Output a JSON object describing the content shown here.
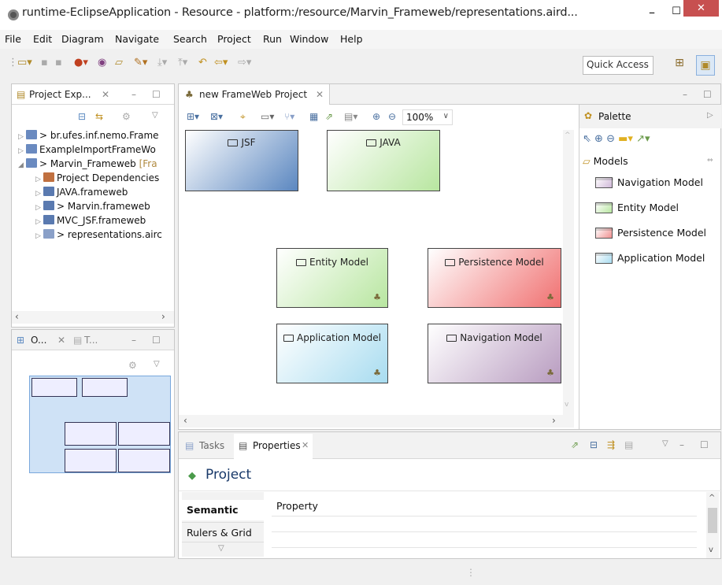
{
  "window": {
    "title": "runtime-EclipseApplication - Resource - platform:/resource/Marvin_Frameweb/representations.aird...",
    "minimize": "–",
    "maximize": "☐",
    "close": "✕"
  },
  "menu": [
    "File",
    "Edit",
    "Diagram",
    "Navigate",
    "Search",
    "Project",
    "Run",
    "Window",
    "Help"
  ],
  "toolbar": {
    "quick_access": "Quick Access"
  },
  "project_explorer": {
    "tab": "Project Exp...",
    "items": [
      {
        "label": "> br.ufes.inf.nemo.Frame",
        "arrow": "▷"
      },
      {
        "label": "ExampleImportFrameWo",
        "arrow": "▷"
      },
      {
        "label": "> Marvin_Frameweb",
        "suffix": "[Fra",
        "arrow": "◢"
      },
      {
        "label": "Project Dependencies",
        "arrow": "▷"
      },
      {
        "label": "JAVA.frameweb",
        "arrow": "▷"
      },
      {
        "label": "> Marvin.frameweb",
        "arrow": "▷"
      },
      {
        "label": "MVC_JSF.frameweb",
        "arrow": "▷"
      },
      {
        "label": "> representations.airc",
        "arrow": "▷"
      }
    ]
  },
  "outline": {
    "tab1": "O...",
    "tab2": "T..."
  },
  "editor": {
    "tab": "new FrameWeb Project",
    "zoom": "100%",
    "nodes": [
      {
        "label": "JSF",
        "color_top": "#ffffff",
        "color_bottom": "#5b87c0"
      },
      {
        "label": "JAVA",
        "color_top": "#ffffff",
        "color_bottom": "#b8e6a0"
      },
      {
        "label": "Entity Model",
        "color_top": "#ffffff",
        "color_bottom": "#b8e6a0"
      },
      {
        "label": "Persistence Model",
        "color_top": "#ffffff",
        "color_bottom": "#f07070"
      },
      {
        "label": "Application Model",
        "color_top": "#ffffff",
        "color_bottom": "#a8dcf0"
      },
      {
        "label": "Navigation Model",
        "color_top": "#ffffff",
        "color_bottom": "#b89cc0"
      }
    ]
  },
  "palette": {
    "title": "Palette",
    "group": "Models",
    "items": [
      {
        "label": "Navigation Model",
        "color": "#d8c8dc"
      },
      {
        "label": "Entity Model",
        "color": "#c8ecb8"
      },
      {
        "label": "Persistence Model",
        "color": "#f4b8b8"
      },
      {
        "label": "Application Model",
        "color": "#c8e8f4"
      }
    ]
  },
  "properties": {
    "tab_tasks": "Tasks",
    "tab_properties": "Properties",
    "heading": "Project",
    "side_tabs": [
      "Semantic",
      "Rulers & Grid"
    ],
    "column_header": "Property"
  }
}
